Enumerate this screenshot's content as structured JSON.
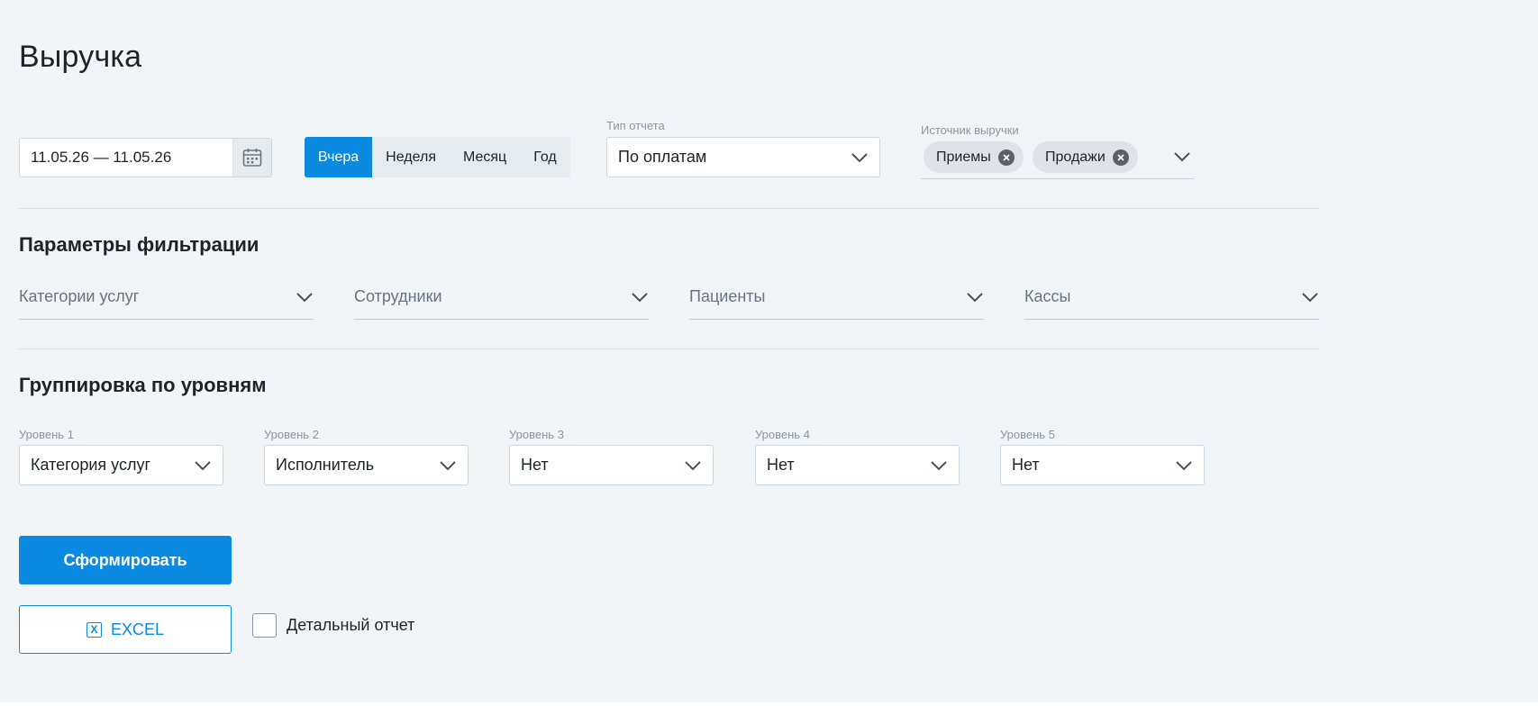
{
  "page": {
    "title": "Выручка"
  },
  "period": {
    "date_range": "11.05.26 — 11.05.26",
    "options": [
      {
        "label": "Вчера",
        "active": true
      },
      {
        "label": "Неделя",
        "active": false
      },
      {
        "label": "Месяц",
        "active": false
      },
      {
        "label": "Год",
        "active": false
      }
    ]
  },
  "report_type": {
    "label": "Тип отчета",
    "value": "По оплатам"
  },
  "revenue_source": {
    "label": "Источник выручки",
    "chips": [
      "Приемы",
      "Продажи"
    ]
  },
  "filters": {
    "title": "Параметры фильтрации",
    "fields": [
      "Категории услуг",
      "Сотрудники",
      "Пациенты",
      "Кассы"
    ]
  },
  "grouping": {
    "title": "Группировка по уровням",
    "levels": [
      {
        "label": "Уровень 1",
        "value": "Категория услуг"
      },
      {
        "label": "Уровень 2",
        "value": "Исполнитель"
      },
      {
        "label": "Уровень 3",
        "value": "Нет"
      },
      {
        "label": "Уровень 4",
        "value": "Нет"
      },
      {
        "label": "Уровень 5",
        "value": "Нет"
      }
    ]
  },
  "actions": {
    "generate": "Сформировать",
    "excel": "EXCEL",
    "excel_icon_glyph": "X",
    "detailed_report": "Детальный отчет"
  },
  "icons": {
    "calendar": "calendar-icon",
    "dropdown": "chevron-down-icon",
    "chip_remove": "close-circle-icon",
    "excel": "excel-icon"
  },
  "colors": {
    "accent": "#0a8ae0",
    "page_background": "#f1f5f8",
    "chip_background": "#dfe3e8"
  }
}
